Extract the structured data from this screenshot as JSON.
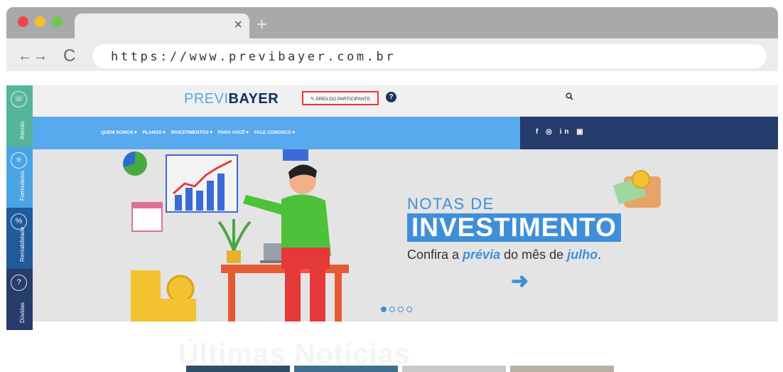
{
  "browser": {
    "close_tab": "×",
    "new_tab": "+",
    "back_forward": "←→",
    "reload": "C",
    "url": "https://www.previbayer.com.br"
  },
  "sidebar": {
    "items": [
      {
        "label": "Atendo",
        "icon": "phone-icon",
        "color": "#55b59a"
      },
      {
        "label": "Formulários",
        "icon": "form-icon",
        "color": "#4aa4e3"
      },
      {
        "label": "Rentabilidade",
        "icon": "chart-icon",
        "color": "#1f5a9a"
      },
      {
        "label": "Dúvidas",
        "icon": "question-icon",
        "color": "#263c6d"
      }
    ]
  },
  "header": {
    "logo_part1": "PREVI",
    "logo_part2": "BAYER",
    "participant_area": "✎ ÁREA DO PARTICIPANTE",
    "help": "?"
  },
  "nav": {
    "items": [
      "QUEM SOMOS ▾",
      "PLANOS ▾",
      "INVESTIMENTOS ▾",
      "PARA VOCÊ ▾",
      "FALE CONOSCO ▾"
    ],
    "social": "f ◎ in ▣"
  },
  "hero": {
    "line1": "NOTAS DE",
    "line2": "INVESTIMENTO",
    "confira_pre": "Confira a ",
    "confira_em1": "prévia",
    "confira_mid": " do mês de ",
    "confira_em2": "julho",
    "confira_end": "."
  },
  "news": {
    "title": "Últimas Notícias"
  },
  "colors": {
    "accent": "#3f8fd8",
    "nav": "#59a9ee",
    "dark": "#263c6d"
  }
}
